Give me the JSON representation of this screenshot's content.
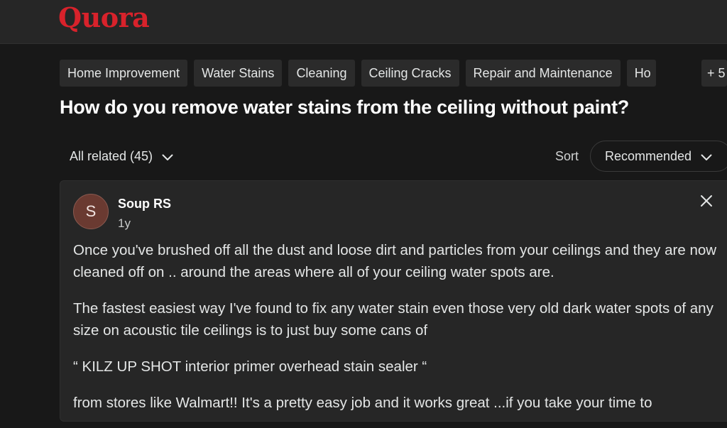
{
  "header": {
    "logo": "Quora"
  },
  "topics": [
    "Home Improvement",
    "Water Stains",
    "Cleaning",
    "Ceiling Cracks",
    "Repair and Maintenance",
    "Ho"
  ],
  "topics_more": "+ 5",
  "question": {
    "title": "How do you remove water stains from the ceiling without paint?"
  },
  "filters": {
    "all_related": "All related (45)",
    "sort_label": "Sort",
    "sort_value": "Recommended"
  },
  "answer": {
    "avatar_letter": "S",
    "author": "Soup RS",
    "age": "1y",
    "paragraphs": [
      "Once you've brushed off all the dust and loose dirt and particles from your ceilings and they are now cleaned off on .. around the areas where all of your ceiling water spots are.",
      "The fastest easiest way I've found to fix any water stain even those very old dark water spots of any size on acoustic tile ceilings is to just buy some cans of",
      "“ KILZ UP SHOT interior primer overhead stain sealer “",
      "from stores like Walmart!! It's a pretty easy job and it works great ...if you take your time to"
    ]
  },
  "colors": {
    "brand": "#d8222b",
    "background": "#181818",
    "surface": "#262626"
  },
  "icons": [
    "chevron-down-icon",
    "close-icon"
  ]
}
